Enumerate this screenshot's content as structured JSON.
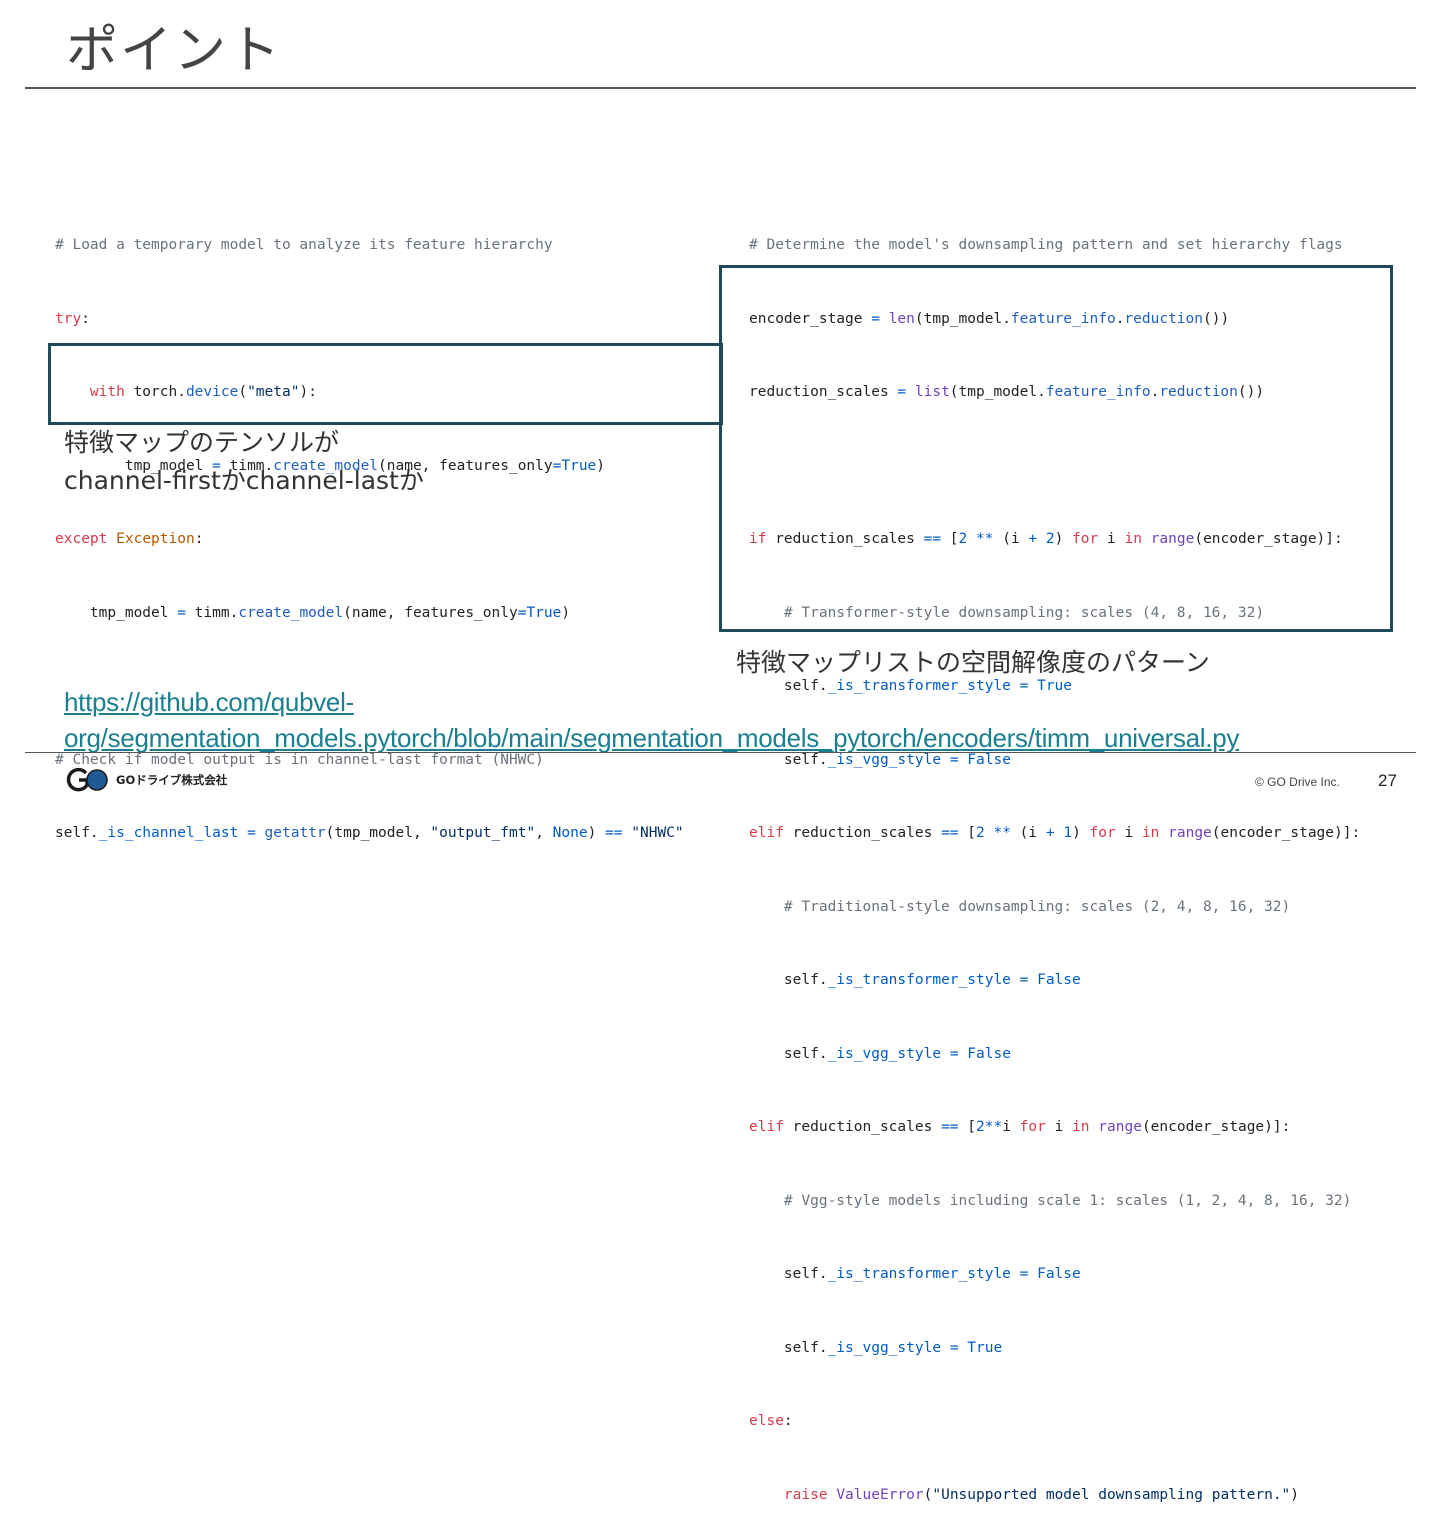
{
  "slide": {
    "title": "ポイント",
    "page_number": "27",
    "copyright": "© GO Drive Inc.",
    "brand_text": "GOドライブ株式会社",
    "brand_colors": {
      "accent": "#1f4b59",
      "link": "#1a7f8f"
    }
  },
  "left_code": {
    "lines": [
      "# Load a temporary model to analyze its feature hierarchy",
      "try:",
      "    with torch.device(\"meta\"):",
      "        tmp_model = timm.create_model(name, features_only=True)",
      "except Exception:",
      "    tmp_model = timm.create_model(name, features_only=True)",
      "",
      "# Check if model output is in channel-last format (NHWC)",
      "self._is_channel_last = getattr(tmp_model, \"output_fmt\", None) == \"NHWC\""
    ]
  },
  "right_code": {
    "lines": [
      "# Determine the model's downsampling pattern and set hierarchy flags",
      "encoder_stage = len(tmp_model.feature_info.reduction())",
      "reduction_scales = list(tmp_model.feature_info.reduction())",
      "",
      "if reduction_scales == [2 ** (i + 2) for i in range(encoder_stage)]:",
      "    # Transformer-style downsampling: scales (4, 8, 16, 32)",
      "    self._is_transformer_style = True",
      "    self._is_vgg_style = False",
      "elif reduction_scales == [2 ** (i + 1) for i in range(encoder_stage)]:",
      "    # Traditional-style downsampling: scales (2, 4, 8, 16, 32)",
      "    self._is_transformer_style = False",
      "    self._is_vgg_style = False",
      "elif reduction_scales == [2**i for i in range(encoder_stage)]:",
      "    # Vgg-style models including scale 1: scales (1, 2, 4, 8, 16, 32)",
      "    self._is_transformer_style = False",
      "    self._is_vgg_style = True",
      "else:",
      "    raise ValueError(\"Unsupported model downsampling pattern.\")"
    ]
  },
  "captions": {
    "left_line1": "特徴マップのテンソルが",
    "left_line2": "channel-firstかchannel-lastか",
    "right": "特徴マップリストの空間解像度のパターン"
  },
  "link": {
    "line1": "https://github.com/qubvel-",
    "line2": "org/segmentation_models.pytorch/blob/main/segmentation_models_pytorch/encoders/timm_universal.py"
  }
}
